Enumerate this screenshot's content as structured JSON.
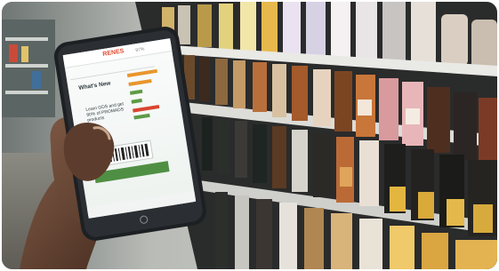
{
  "phone": {
    "brand": "RENES",
    "battery": "97%",
    "heading": "What's New",
    "promo": "Learn GDS and get 80% of PROMADS products"
  },
  "colors": {
    "green_bar": "#5f9a45",
    "orange_bar": "#e8962e",
    "red_bar": "#d9452f"
  }
}
